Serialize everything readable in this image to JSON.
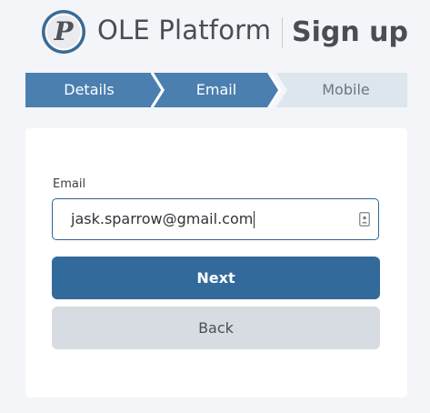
{
  "header": {
    "brand_title": "OLE Platform",
    "page_title": "Sign up",
    "logo_letter": "P"
  },
  "stepper": {
    "steps": [
      {
        "label": "Details",
        "state": "completed"
      },
      {
        "label": "Email",
        "state": "current"
      },
      {
        "label": "Mobile",
        "state": "upcoming"
      }
    ]
  },
  "form": {
    "email_label": "Email",
    "email_value": "jask.sparrow@gmail.com",
    "next_label": "Next",
    "back_label": "Back"
  },
  "colors": {
    "primary": "#336a9c",
    "step_active": "#4a7fb0",
    "step_inactive": "#dde5ed",
    "secondary_button": "#d7dbe2",
    "background": "#f3f5f8"
  }
}
